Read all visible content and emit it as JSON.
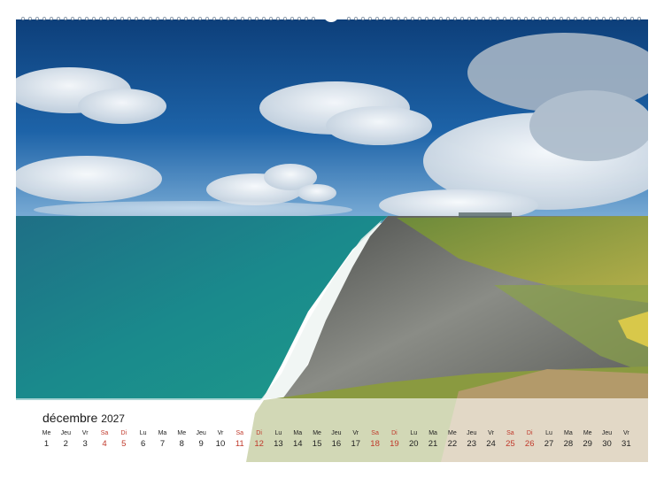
{
  "calendar": {
    "month": "décembre",
    "year": "2027",
    "colors": {
      "weekday": "#222222",
      "weekend": "#c0392b"
    },
    "days": [
      {
        "dow": "Me",
        "num": "1",
        "weekend": false
      },
      {
        "dow": "Jeu",
        "num": "2",
        "weekend": false
      },
      {
        "dow": "Vr",
        "num": "3",
        "weekend": false
      },
      {
        "dow": "Sa",
        "num": "4",
        "weekend": true
      },
      {
        "dow": "Di",
        "num": "5",
        "weekend": true
      },
      {
        "dow": "Lu",
        "num": "6",
        "weekend": false
      },
      {
        "dow": "Ma",
        "num": "7",
        "weekend": false
      },
      {
        "dow": "Me",
        "num": "8",
        "weekend": false
      },
      {
        "dow": "Jeu",
        "num": "9",
        "weekend": false
      },
      {
        "dow": "Vr",
        "num": "10",
        "weekend": false
      },
      {
        "dow": "Sa",
        "num": "11",
        "weekend": true
      },
      {
        "dow": "Di",
        "num": "12",
        "weekend": true
      },
      {
        "dow": "Lu",
        "num": "13",
        "weekend": false
      },
      {
        "dow": "Ma",
        "num": "14",
        "weekend": false
      },
      {
        "dow": "Me",
        "num": "15",
        "weekend": false
      },
      {
        "dow": "Jeu",
        "num": "16",
        "weekend": false
      },
      {
        "dow": "Vr",
        "num": "17",
        "weekend": false
      },
      {
        "dow": "Sa",
        "num": "18",
        "weekend": true
      },
      {
        "dow": "Di",
        "num": "19",
        "weekend": true
      },
      {
        "dow": "Lu",
        "num": "20",
        "weekend": false
      },
      {
        "dow": "Ma",
        "num": "21",
        "weekend": false
      },
      {
        "dow": "Me",
        "num": "22",
        "weekend": false
      },
      {
        "dow": "Jeu",
        "num": "23",
        "weekend": false
      },
      {
        "dow": "Vr",
        "num": "24",
        "weekend": false
      },
      {
        "dow": "Sa",
        "num": "25",
        "weekend": true
      },
      {
        "dow": "Di",
        "num": "26",
        "weekend": true
      },
      {
        "dow": "Lu",
        "num": "27",
        "weekend": false
      },
      {
        "dow": "Ma",
        "num": "28",
        "weekend": false
      },
      {
        "dow": "Me",
        "num": "29",
        "weekend": false
      },
      {
        "dow": "Jeu",
        "num": "30",
        "weekend": false
      },
      {
        "dow": "Vr",
        "num": "31",
        "weekend": false
      }
    ]
  }
}
